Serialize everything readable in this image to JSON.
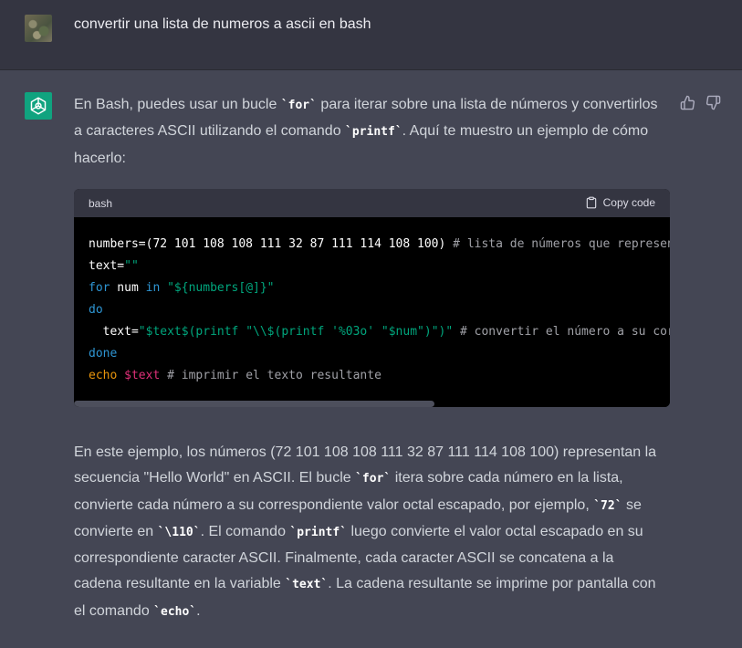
{
  "user_message": {
    "text": "convertir una lista de numeros a ascii en bash"
  },
  "assistant": {
    "intro": [
      "En Bash, puedes usar un bucle ",
      "`for`",
      " para iterar sobre una lista de números y convertirlos a caracteres ASCII utilizando el comando ",
      "`printf`",
      ". Aquí te muestro un ejemplo de cómo hacerlo:"
    ],
    "code_block": {
      "language": "bash",
      "copy_label": "Copy code",
      "lines": [
        [
          [
            "",
            "numbers=(72 101 108 108 111 32 87 111 114 108 100) "
          ],
          [
            "cmt",
            "# lista de números que representan la secuencia \"Hello World\" en ASCII"
          ]
        ],
        [
          [
            "",
            "text="
          ],
          [
            "str",
            "\"\""
          ]
        ],
        [
          [
            "kw",
            "for"
          ],
          [
            "",
            " num "
          ],
          [
            "kw",
            "in"
          ],
          [
            "",
            " "
          ],
          [
            "str",
            "\"${numbers[@]}\""
          ]
        ],
        [
          [
            "kw",
            "do"
          ]
        ],
        [
          [
            "",
            "  text="
          ],
          [
            "str",
            "\"$text$(printf \"\\\\$(printf '%03o' \"$num\")\")\""
          ],
          [
            "",
            " "
          ],
          [
            "cmt",
            "# convertir el número a su correspondiente caracter ASCII"
          ]
        ],
        [
          [
            "kw",
            "done"
          ]
        ],
        [
          [
            "fn",
            "echo"
          ],
          [
            "",
            " "
          ],
          [
            "vr",
            "$text"
          ],
          [
            "",
            " "
          ],
          [
            "cmt",
            "# imprimir el texto resultante"
          ]
        ]
      ]
    },
    "explanation": [
      "En este ejemplo, los números (72 101 108 108 111 32 87 111 114 108 100) representan la secuencia \"Hello World\" en ASCII. El bucle ",
      "`for`",
      " itera sobre cada número en la lista, convierte cada número a su correspondiente valor octal escapado, por ejemplo, ",
      "`72`",
      " se convierte en ",
      "`\\110`",
      ". El comando ",
      "`printf`",
      " luego convierte el valor octal escapado en su correspondiente caracter ASCII. Finalmente, cada caracter ASCII se concatena a la cadena resultante en la variable ",
      "`text`",
      ". La cadena resultante se imprime por pantalla con el comando ",
      "`echo`",
      "."
    ]
  },
  "icons": {
    "user_avatar": "user-avatar-photo",
    "assistant_avatar": "openai-logo-icon",
    "thumbs_up": "thumbs-up-icon",
    "thumbs_down": "thumbs-down-icon",
    "copy": "clipboard-icon"
  },
  "colors": {
    "page_bg": "#444654",
    "user_row_bg": "#343541",
    "brand_green": "#10a37f",
    "code_bg": "#000000",
    "code_header_bg": "#343541"
  }
}
